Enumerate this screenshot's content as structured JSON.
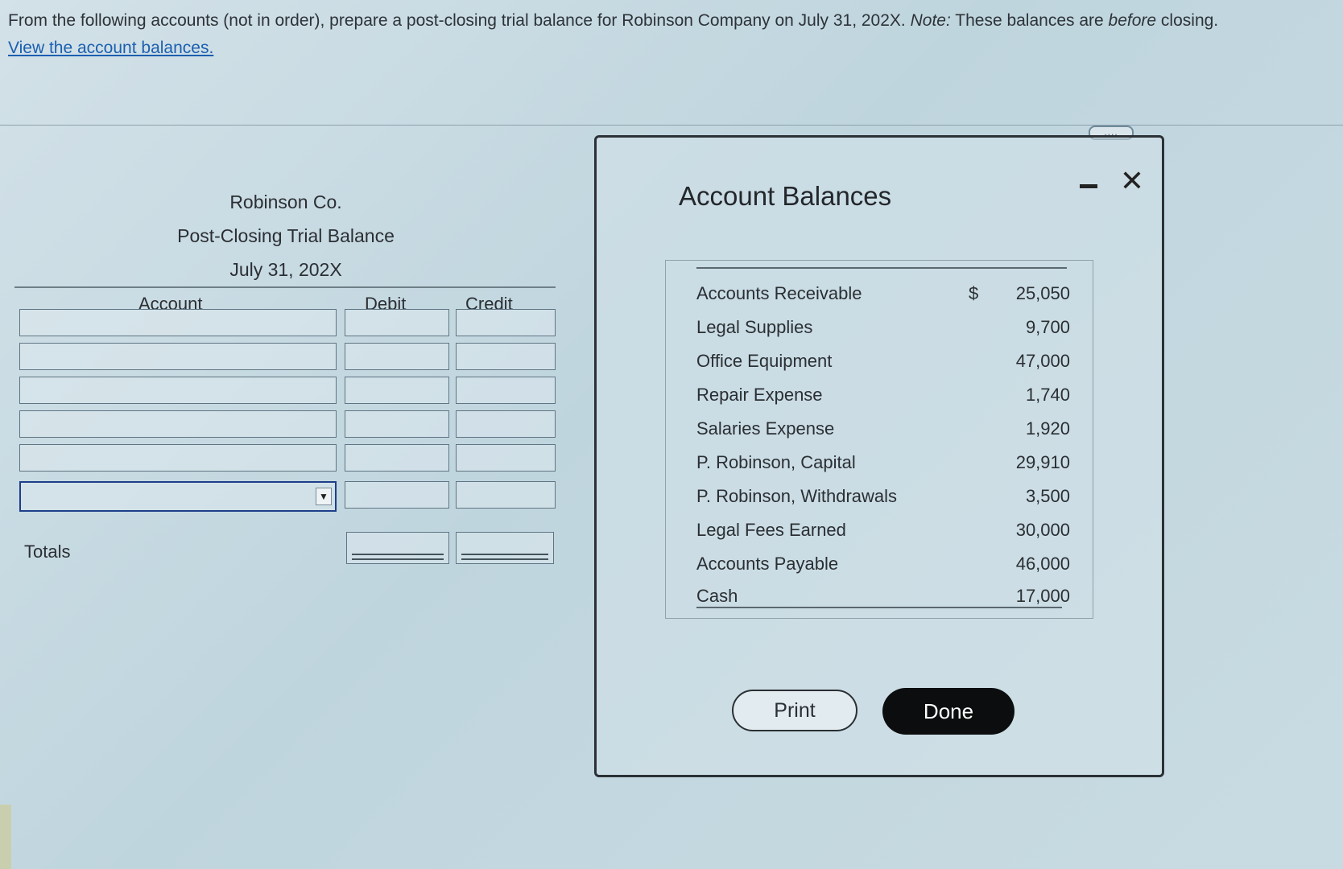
{
  "instructions": {
    "lead": "From the following accounts (not in order), prepare a post-closing trial balance for Robinson Company on July 31, 202X. ",
    "note_label": "Note:",
    "note_pre": " These balances are ",
    "note_emph": "before",
    "note_post": " closing.",
    "link": "View the account balances."
  },
  "expander": "....",
  "worksheet": {
    "company": "Robinson Co.",
    "title": "Post-Closing Trial Balance",
    "date": "July 31, 202X",
    "col_account": "Account",
    "col_debit": "Debit",
    "col_credit": "Credit",
    "totals_label": "Totals",
    "select_arrow": "▼"
  },
  "modal": {
    "title": "Account Balances",
    "dollar_sign": "$",
    "accounts": [
      {
        "name": "Accounts Receivable",
        "amount": "25,050"
      },
      {
        "name": "Legal Supplies",
        "amount": "9,700"
      },
      {
        "name": "Office Equipment",
        "amount": "47,000"
      },
      {
        "name": "Repair Expense",
        "amount": "1,740"
      },
      {
        "name": "Salaries Expense",
        "amount": "1,920"
      },
      {
        "name": "P. Robinson, Capital",
        "amount": "29,910"
      },
      {
        "name": "P. Robinson, Withdrawals",
        "amount": "3,500"
      },
      {
        "name": "Legal Fees Earned",
        "amount": "30,000"
      },
      {
        "name": "Accounts Payable",
        "amount": "46,000"
      },
      {
        "name": "Cash",
        "amount": "17,000"
      }
    ],
    "print_label": "Print",
    "done_label": "Done",
    "close_glyph": "✕"
  }
}
